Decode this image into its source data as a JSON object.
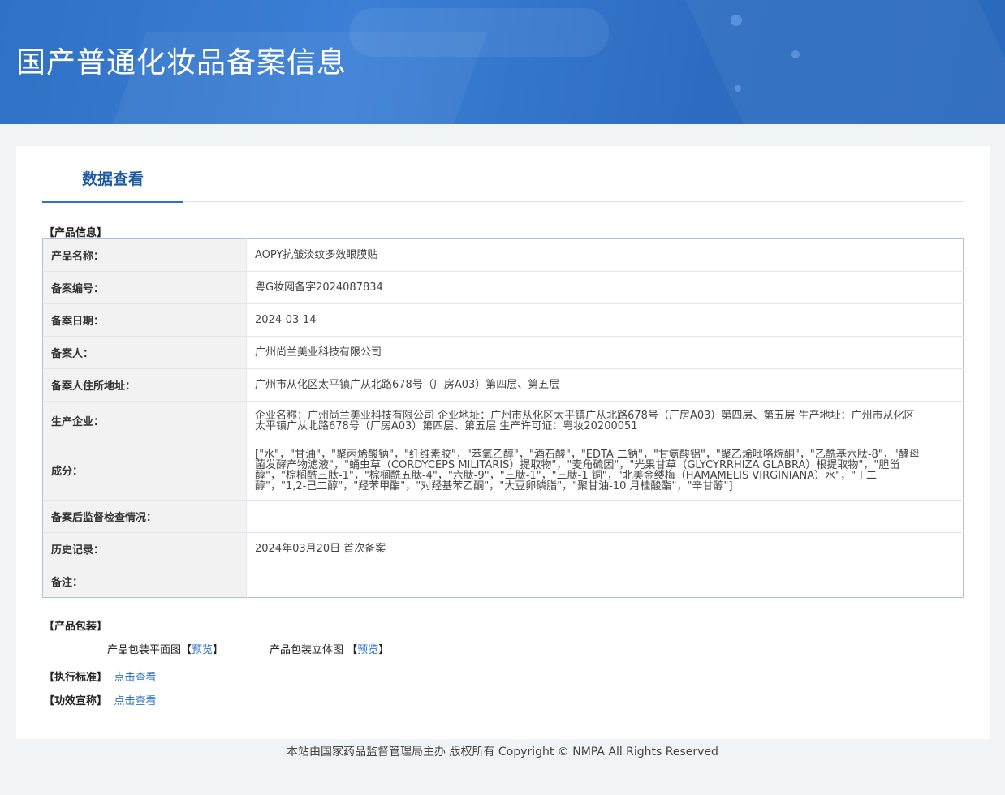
{
  "banner": {
    "title": "国产普通化妆品备案信息"
  },
  "tab": {
    "label": "数据查看"
  },
  "product_info": {
    "section_title": "【产品信息】",
    "rows": [
      {
        "key": "产品名称：",
        "value": "AOPY抗皱淡纹多效眼膜贴"
      },
      {
        "key": "备案编号：",
        "value": "粤G妆网备字2024087834"
      },
      {
        "key": "备案日期：",
        "value": "2024-03-14"
      },
      {
        "key": "备案人：",
        "value": "广州尚兰美业科技有限公司"
      },
      {
        "key": "备案人住所地址：",
        "value": "广州市从化区太平镇广从北路678号（厂房A03）第四层、第五层"
      },
      {
        "key": "生产企业：",
        "value": "企业名称：广州尚兰美业科技有限公司 企业地址：广州市从化区太平镇广从北路678号（厂房A03）第四层、第五层 生产地址：广州市从化区太平镇广从北路678号（厂房A03）第四层、第五层 生产许可证：粤妆20200051"
      },
      {
        "key": "成分：",
        "value": "[\"水\"，\"甘油\"，\"聚丙烯酸钠\"，\"纤维素胶\"，\"苯氧乙醇\"，\"酒石酸\"，\"EDTA 二钠\"，\"甘氨酸铝\"，\"聚乙烯吡咯烷酮\"，\"乙酰基六肽-8\"，\"酵母菌发酵产物滤液\"，\"蛹虫草（CORDYCEPS MILITARIS）提取物\"，\"麦角硫因\"，\"光果甘草（GLYCYRRHIZA GLABRA）根提取物\"，\"胆甾醇\"，\"棕榈酰三肽-1\"，\"棕榈酰五肽-4\"，\"六肽-9\"，\"三肽-1\"，\"三肽-1 铜\"，\"北美金缕梅（HAMAMELIS VIRGINIANA）水\"，\"丁二醇\"，\"1,2-己二醇\"，\"羟苯甲酯\"，\"对羟基苯乙酮\"，\"大豆卵磷脂\"，\"聚甘油-10 月桂酸酯\"，\"辛甘醇\"]"
      },
      {
        "key": "备案后监督检查情况：",
        "value": ""
      },
      {
        "key": "历史记录：",
        "value": "2024年03月20日 首次备案"
      },
      {
        "key": "备注：",
        "value": ""
      }
    ]
  },
  "packaging": {
    "section_title": "【产品包装】",
    "flat_label": "产品包装平面图",
    "solid_label": "产品包装立体图",
    "preview_label": "预览",
    "bracket_open": "【",
    "bracket_close": "】"
  },
  "standard": {
    "section_title": "【执行标准】",
    "link": "点击查看"
  },
  "efficacy": {
    "section_title": "【功效宣称】",
    "link": "点击查看"
  },
  "footer": {
    "text": "本站由国家药品监督管理局主办 版权所有 Copyright © NMPA All Rights Reserved"
  }
}
